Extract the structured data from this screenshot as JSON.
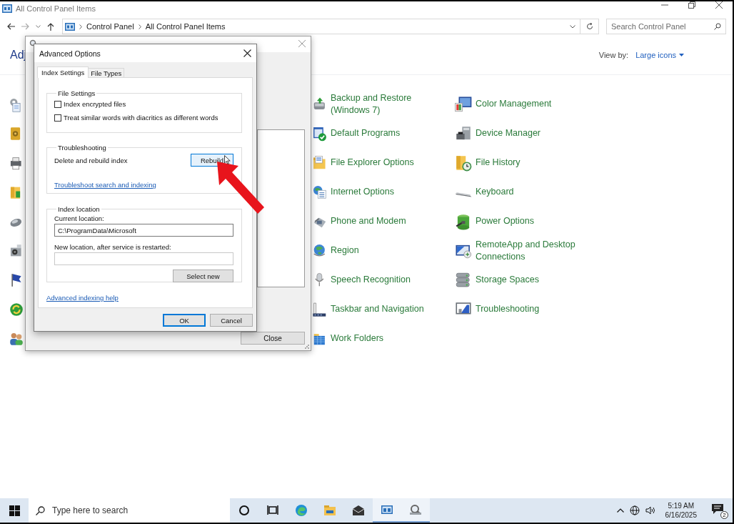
{
  "window": {
    "title": "All Control Panel Items"
  },
  "address_bar": {
    "path": [
      "Control Panel",
      "All Control Panel Items"
    ]
  },
  "search": {
    "placeholder": "Search Control Panel"
  },
  "heading": "Adj",
  "view_by": {
    "label": "View by:",
    "value": "Large icons"
  },
  "items": [
    {
      "label": "Backup and Restore\n(Windows 7)"
    },
    {
      "label": "Default Programs"
    },
    {
      "label": "File Explorer Options"
    },
    {
      "label": "Internet Options"
    },
    {
      "label": "Phone and Modem"
    },
    {
      "label": "Region"
    },
    {
      "label": "Speech Recognition"
    },
    {
      "label": "Taskbar and Navigation"
    },
    {
      "label": "Work Folders"
    },
    {
      "label": "Color Management"
    },
    {
      "label": "Device Manager"
    },
    {
      "label": "File History"
    },
    {
      "label": "Keyboard"
    },
    {
      "label": "Power Options"
    },
    {
      "label": "RemoteApp and Desktop\nConnections"
    },
    {
      "label": "Storage Spaces"
    },
    {
      "label": "Troubleshooting"
    }
  ],
  "indexing_options": {
    "close_button": "Close"
  },
  "advanced_options": {
    "title": "Advanced Options",
    "tabs": [
      {
        "label": "Index Settings",
        "selected": true
      },
      {
        "label": "File Types",
        "selected": false
      }
    ],
    "file_settings": {
      "title": "File Settings",
      "options": [
        {
          "label": "Index encrypted files",
          "checked": false
        },
        {
          "label": "Treat similar words with diacritics as different words",
          "checked": false
        }
      ]
    },
    "troubleshooting": {
      "title": "Troubleshooting",
      "description": "Delete and rebuild index",
      "button": "Rebuild",
      "link": "Troubleshoot search and indexing"
    },
    "index_location": {
      "title": "Index location",
      "current_label": "Current location:",
      "current_value": "C:\\ProgramData\\Microsoft",
      "new_label": "New location, after service is restarted:",
      "button": "Select new"
    },
    "help_link": "Advanced indexing help",
    "buttons": [
      {
        "label": "OK",
        "default": true
      },
      {
        "label": "Cancel",
        "default": false
      }
    ]
  },
  "taskbar": {
    "search_placeholder": "Type here to search",
    "apps": [
      {
        "kind": "cortana",
        "active": false
      },
      {
        "kind": "taskview",
        "active": false
      },
      {
        "kind": "browser",
        "active": false
      },
      {
        "kind": "explorer",
        "active": false
      },
      {
        "kind": "mail",
        "active": false
      },
      {
        "kind": "controlpanel",
        "active": true
      },
      {
        "kind": "indexing",
        "active": true
      }
    ],
    "time": "5:19 AM",
    "date": "6/16/2025",
    "notification_count": "2"
  }
}
